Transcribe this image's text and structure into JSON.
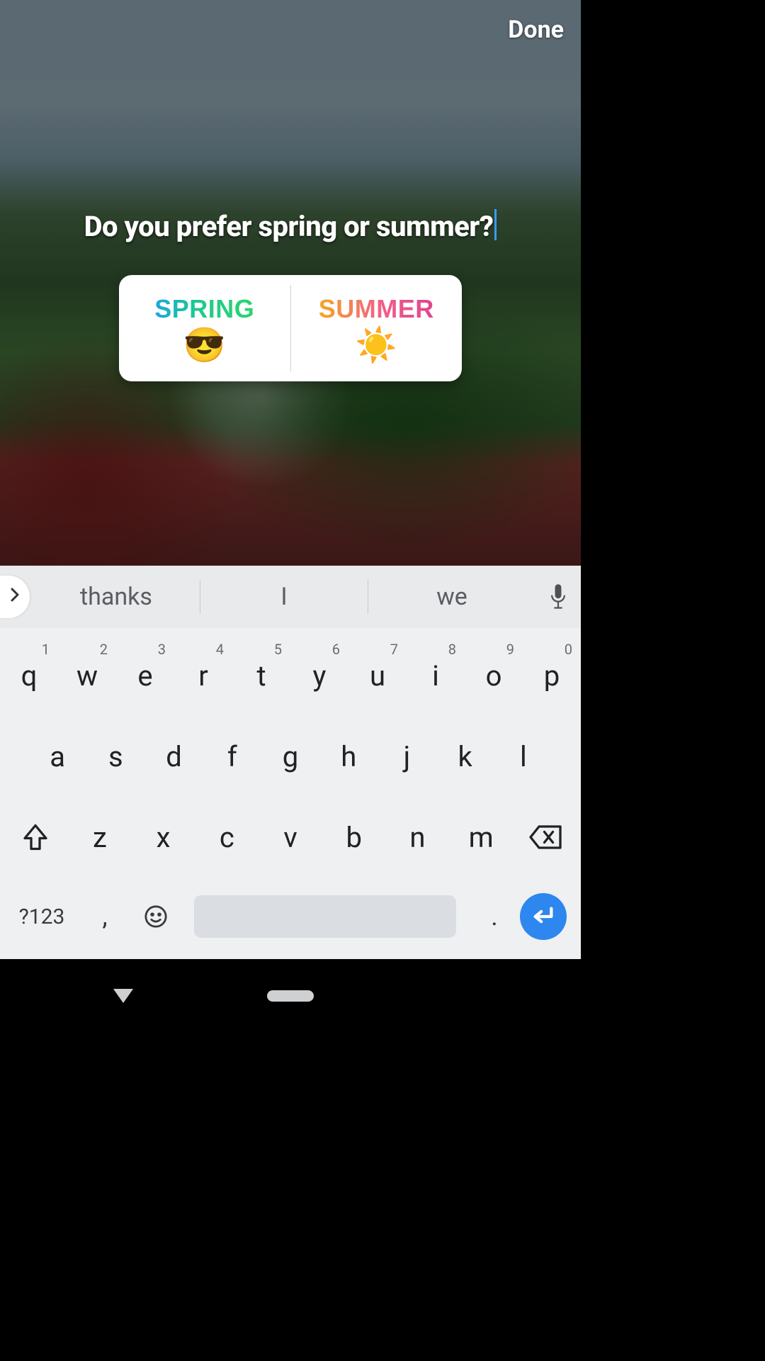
{
  "header": {
    "done_label": "Done"
  },
  "question": {
    "text": "Do you prefer spring or summer?"
  },
  "poll": {
    "options": [
      {
        "label": "SPRING",
        "emoji": "😎",
        "gradient": "grad-spring"
      },
      {
        "label": "SUMMER",
        "emoji": "☀️",
        "gradient": "grad-summer"
      }
    ]
  },
  "suggestions": {
    "items": [
      "thanks",
      "I",
      "we"
    ]
  },
  "keyboard": {
    "row1": [
      {
        "k": "q",
        "n": "1"
      },
      {
        "k": "w",
        "n": "2"
      },
      {
        "k": "e",
        "n": "3"
      },
      {
        "k": "r",
        "n": "4"
      },
      {
        "k": "t",
        "n": "5"
      },
      {
        "k": "y",
        "n": "6"
      },
      {
        "k": "u",
        "n": "7"
      },
      {
        "k": "i",
        "n": "8"
      },
      {
        "k": "o",
        "n": "9"
      },
      {
        "k": "p",
        "n": "0"
      }
    ],
    "row2": [
      "a",
      "s",
      "d",
      "f",
      "g",
      "h",
      "j",
      "k",
      "l"
    ],
    "row3": [
      "z",
      "x",
      "c",
      "v",
      "b",
      "n",
      "m"
    ],
    "sym_label": "?123",
    "comma": ",",
    "dot": "."
  }
}
